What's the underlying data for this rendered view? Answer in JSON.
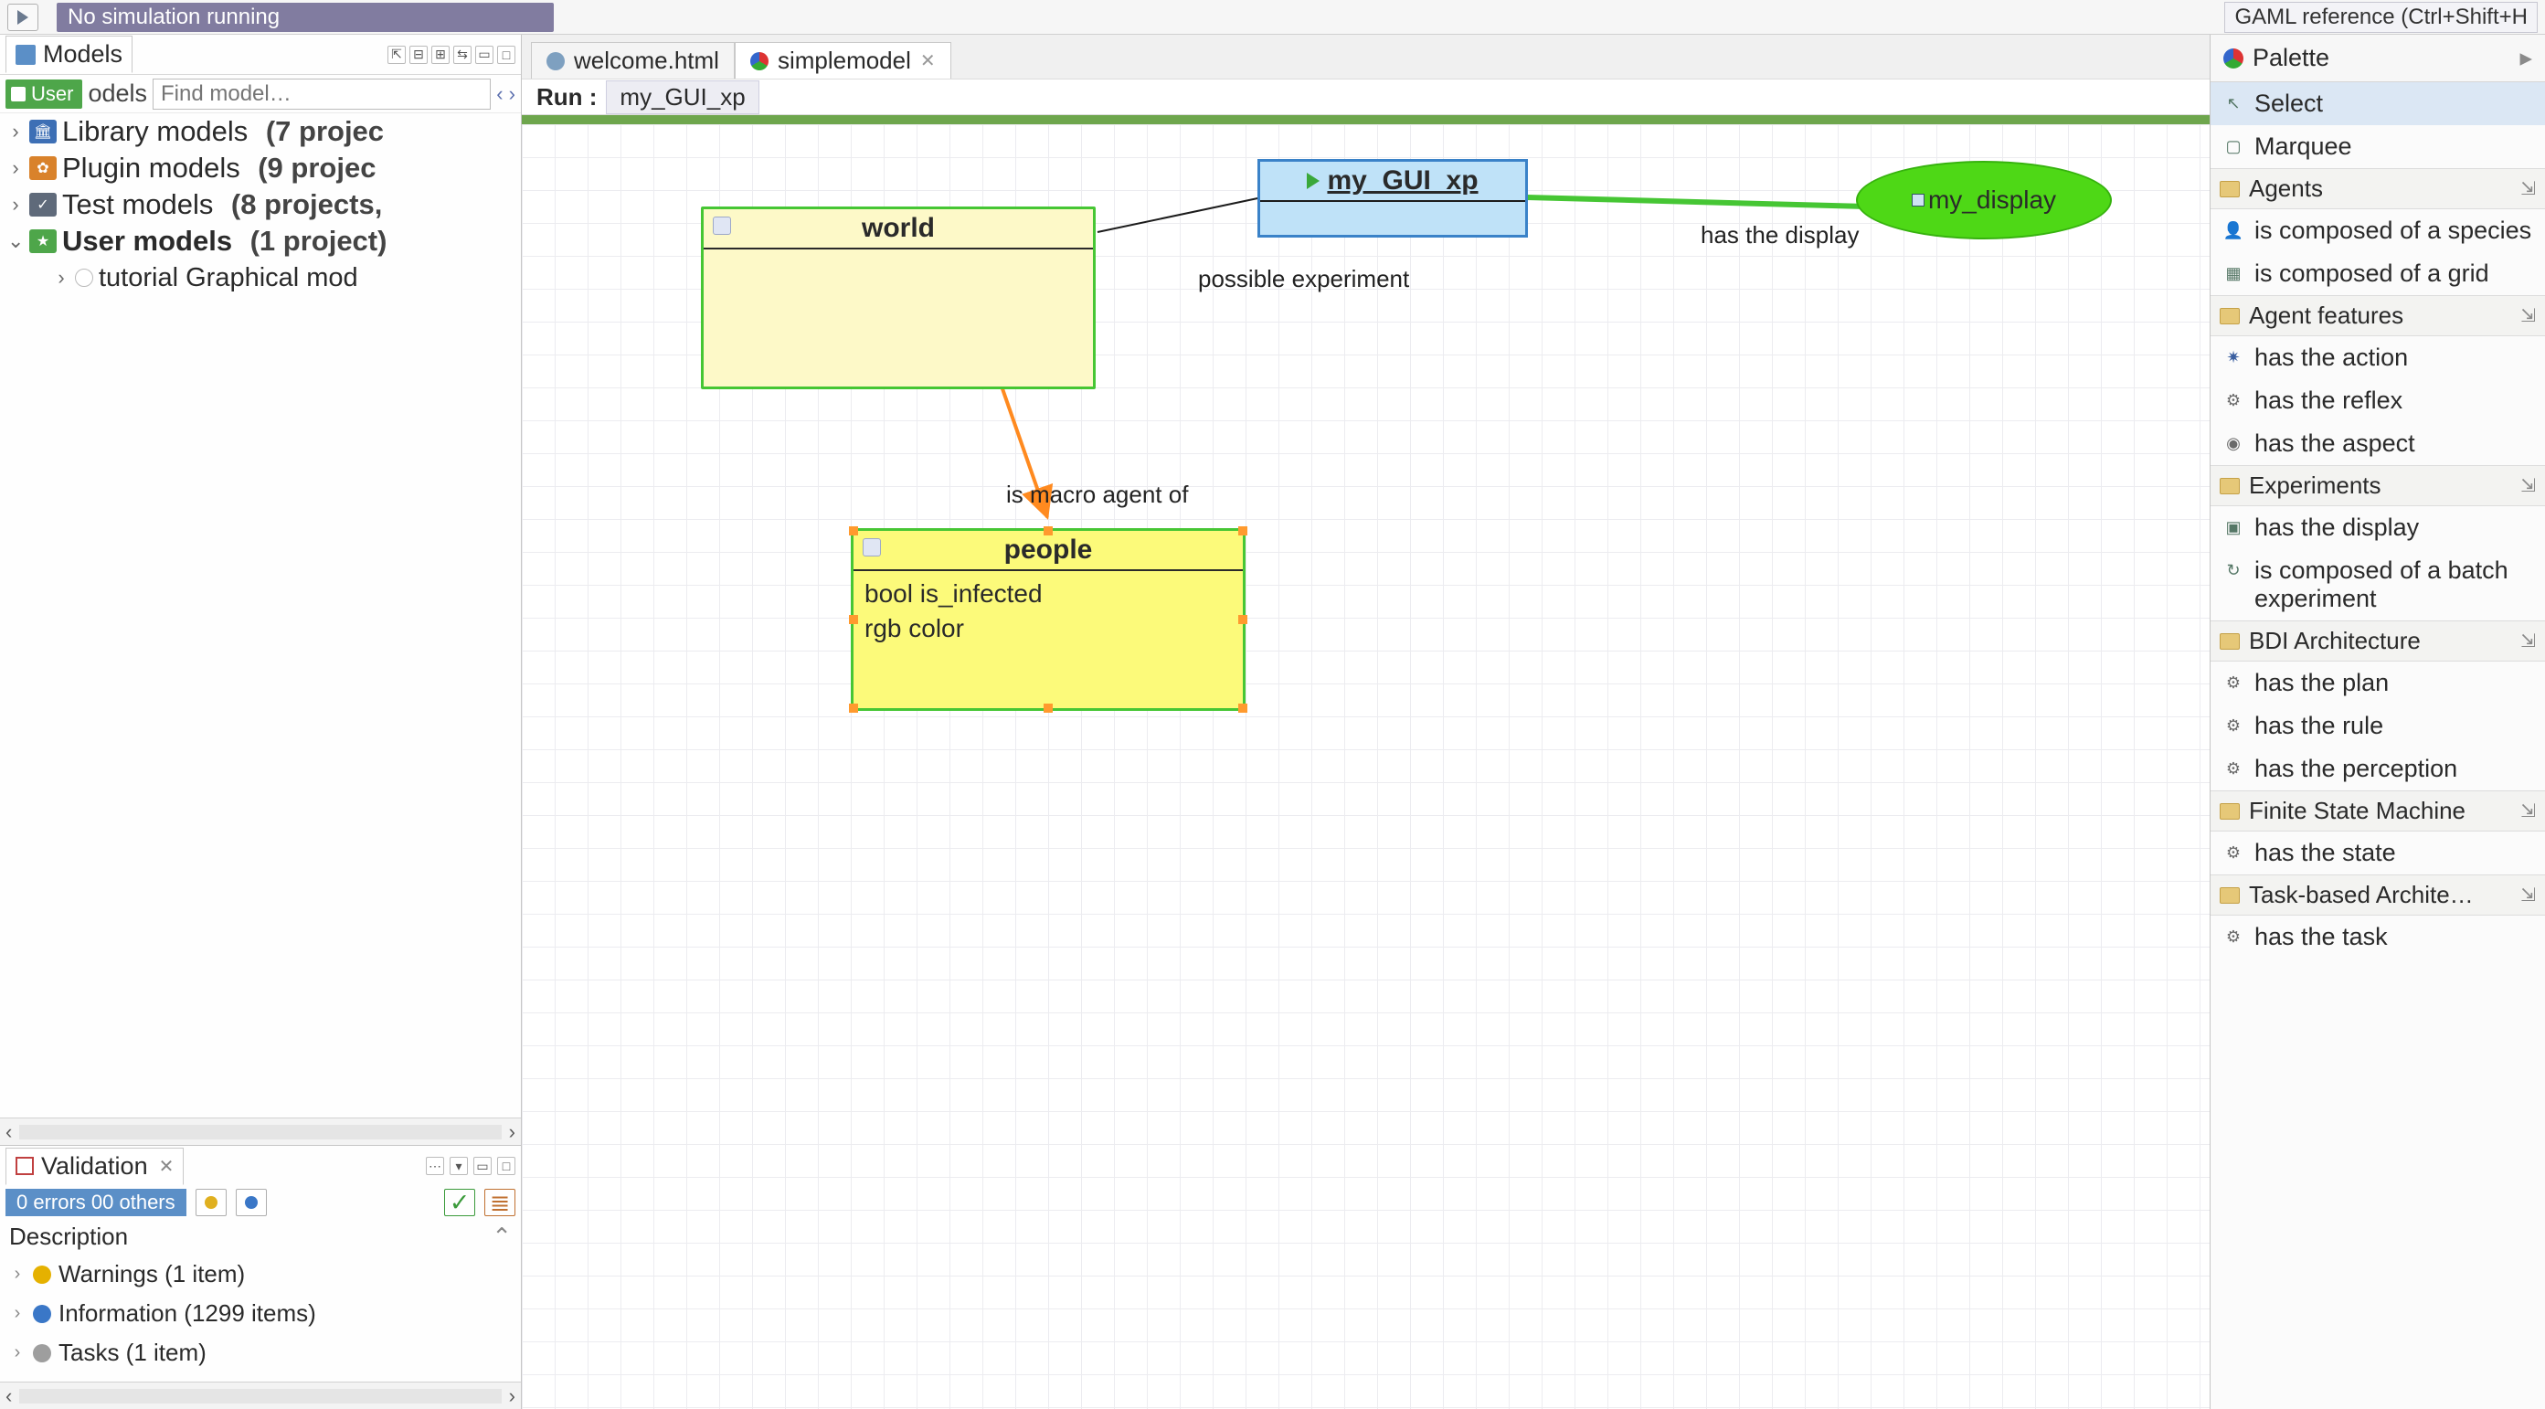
{
  "top": {
    "sim_status": "No simulation running",
    "gaml_ref": "GAML reference (Ctrl+Shift+H"
  },
  "models_view": {
    "title": "Models",
    "crumb": {
      "user": "User",
      "suffix": "odels"
    },
    "find_placeholder": "Find model…",
    "tree": [
      {
        "label": "Library models",
        "count": "(7 projec",
        "icon": "lib",
        "bold": false
      },
      {
        "label": "Plugin models",
        "count": "(9 projec",
        "icon": "plug",
        "bold": false
      },
      {
        "label": "Test models",
        "count": "(8 projects,",
        "icon": "test",
        "bold": false
      },
      {
        "label": "User models",
        "count": "(1 project)",
        "icon": "user",
        "bold": true
      }
    ],
    "child": "tutorial Graphical mod"
  },
  "validation": {
    "title": "Validation",
    "err_summary": "0 errors   00 others",
    "description_label": "Description",
    "items": [
      {
        "kind": "warn",
        "label": "Warnings (1 item)"
      },
      {
        "kind": "info",
        "label": "Information (1299 items)"
      },
      {
        "kind": "task",
        "label": "Tasks (1 item)"
      }
    ]
  },
  "editor": {
    "tabs": [
      {
        "id": "welcome",
        "label": "welcome.html",
        "icon": "wel",
        "active": false
      },
      {
        "id": "simple",
        "label": "simplemodel",
        "icon": "gaml",
        "active": true
      }
    ],
    "run_label": "Run :",
    "run_value": "my_GUI_xp"
  },
  "diagram": {
    "world": {
      "title": "world"
    },
    "people": {
      "title": "people",
      "attrs": [
        "bool is_infected",
        "rgb color"
      ]
    },
    "exp": {
      "title": "my_GUI_xp"
    },
    "display": {
      "title": "my_display"
    },
    "edges": {
      "world_exp": "possible experiment",
      "world_people": "is macro agent of",
      "exp_display": "has the display"
    }
  },
  "palette": {
    "title": "Palette",
    "tools": [
      {
        "label": "Select",
        "ico": "cursor",
        "selected": true
      },
      {
        "label": "Marquee",
        "ico": "marquee",
        "selected": false
      }
    ],
    "drawers": [
      {
        "title": "Agents",
        "items": [
          {
            "ico": "person",
            "label": "is composed of a species"
          },
          {
            "ico": "grid",
            "label": "is composed of a grid"
          }
        ]
      },
      {
        "title": "Agent features",
        "items": [
          {
            "ico": "star",
            "label": "has the action"
          },
          {
            "ico": "gear",
            "label": "has the reflex"
          },
          {
            "ico": "eye",
            "label": "has the aspect"
          }
        ]
      },
      {
        "title": "Experiments",
        "items": [
          {
            "ico": "disp",
            "label": "has the display"
          },
          {
            "ico": "cycle",
            "label": "is composed of a batch experiment"
          }
        ]
      },
      {
        "title": "BDI Architecture",
        "items": [
          {
            "ico": "gear",
            "label": "has the plan"
          },
          {
            "ico": "gear",
            "label": "has the rule"
          },
          {
            "ico": "gear",
            "label": "has the perception"
          }
        ]
      },
      {
        "title": "Finite State Machine",
        "items": [
          {
            "ico": "gear",
            "label": "has the state"
          }
        ]
      },
      {
        "title": "Task-based Archite…",
        "items": [
          {
            "ico": "gear",
            "label": "has the task"
          }
        ]
      }
    ]
  }
}
